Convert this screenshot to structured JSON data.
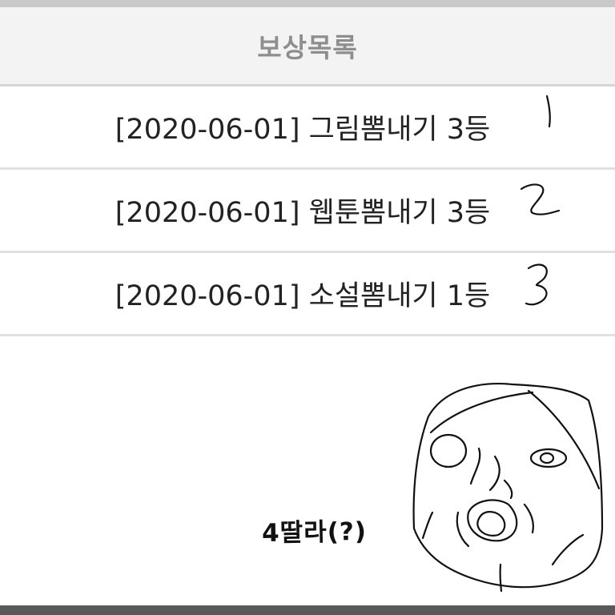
{
  "header": {
    "title": "보상목록"
  },
  "rewards": [
    {
      "text": "[2020-06-01] 그림뽐내기 3등",
      "annotation": "1"
    },
    {
      "text": "[2020-06-01] 웹툰뽐내기 3등",
      "annotation": "2"
    },
    {
      "text": "[2020-06-01] 소설뽐내기 1등",
      "annotation": "3"
    }
  ],
  "doodle": {
    "caption": "4딸라(?)"
  }
}
